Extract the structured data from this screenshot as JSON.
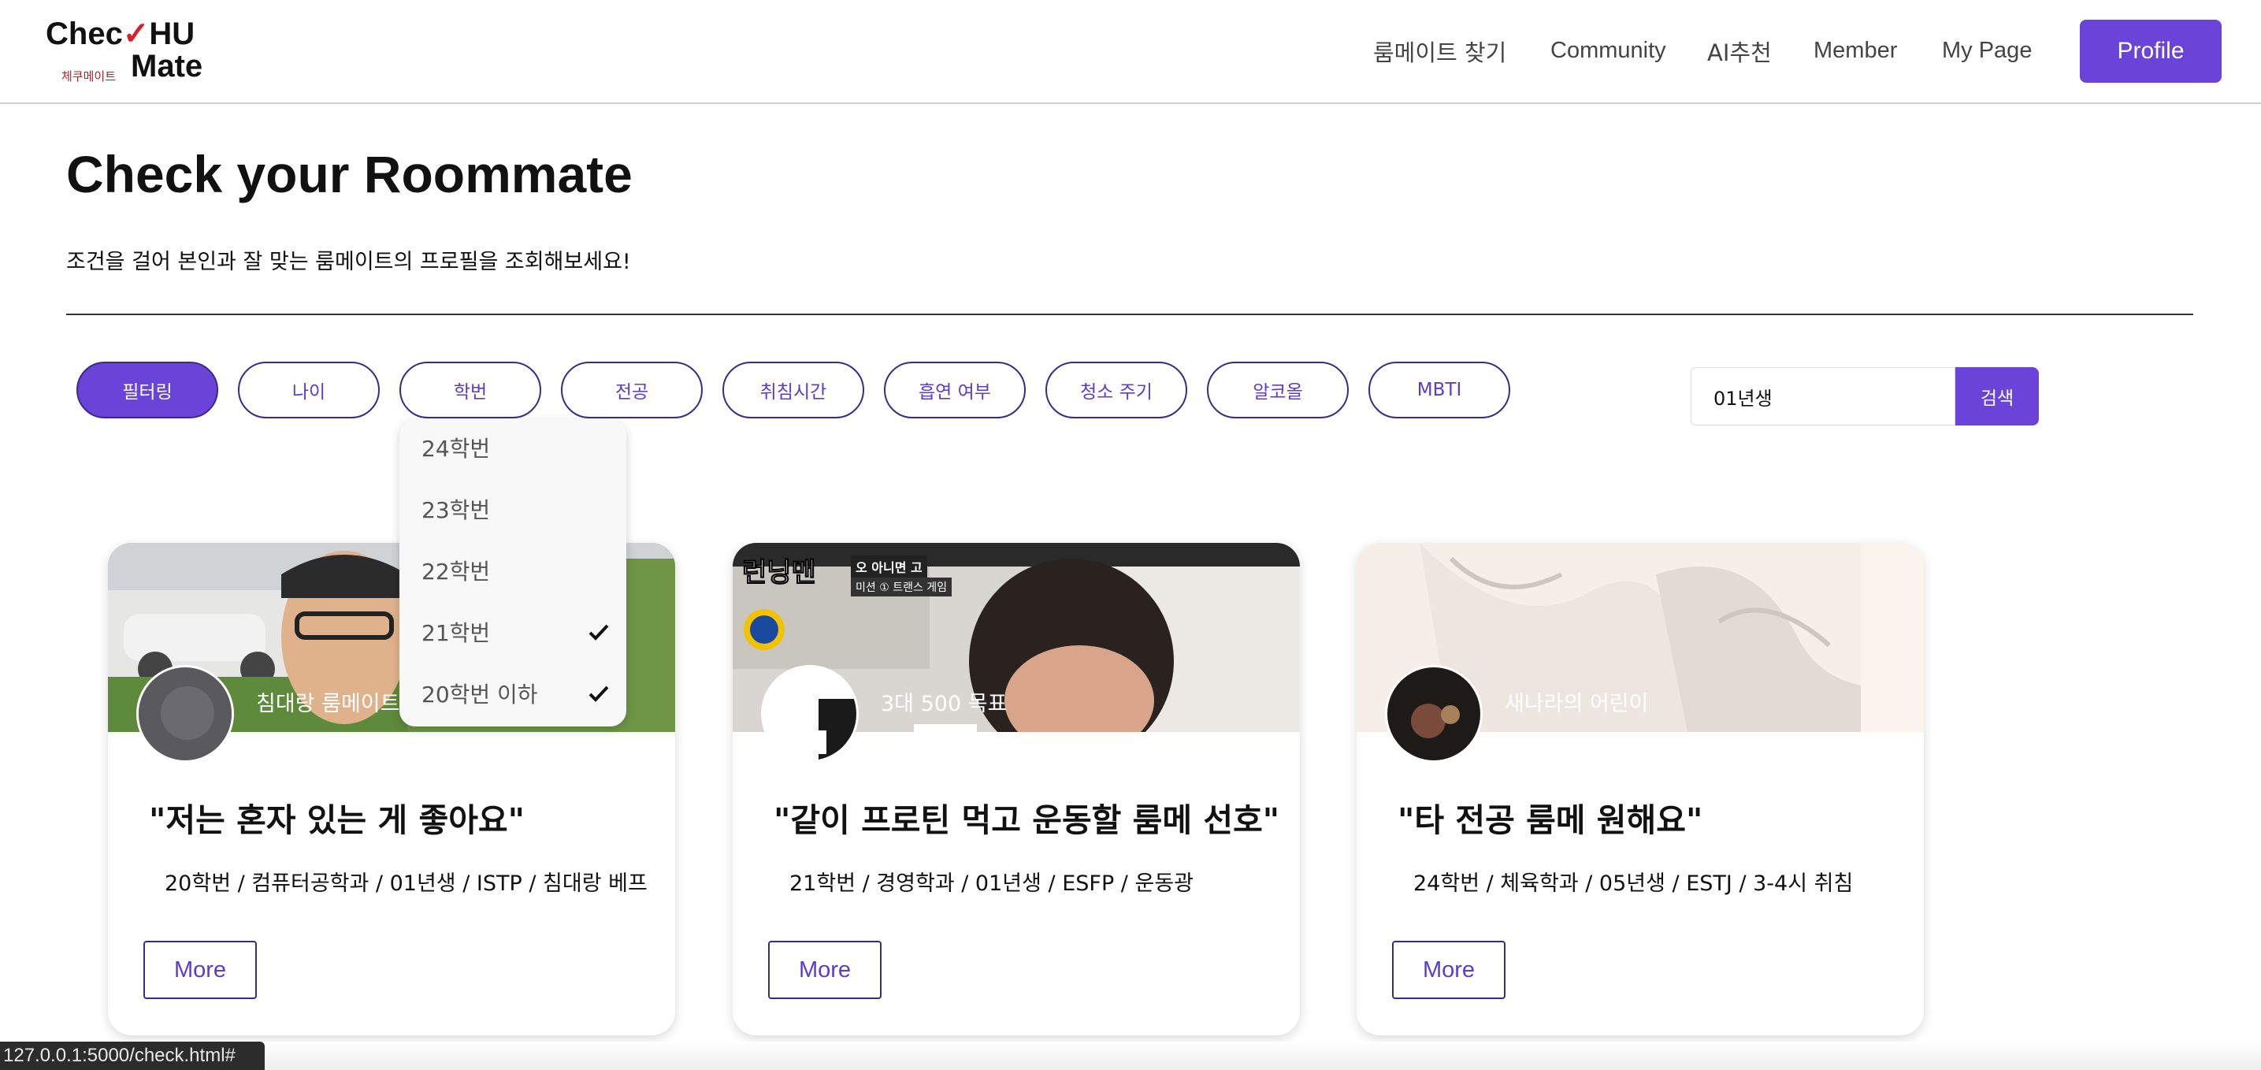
{
  "header": {
    "logo": {
      "line1": "Chec",
      "check": "✓",
      "line1_tail": "HU",
      "line2": "Mate",
      "sub": "체쿠메이트"
    },
    "nav": {
      "find_roommate": "룸메이트 찾기",
      "community": "Community",
      "ai_recommend": "AI추천",
      "member": "Member",
      "my_page": "My Page"
    },
    "profile_button": "Profile"
  },
  "page": {
    "title": "Check your Roommate",
    "description": "조건을 걸어 본인과 잘 맞는 룸메이트의 프로필을 조회해보세요!"
  },
  "filters": {
    "chips": [
      "필터링",
      "나이",
      "학번",
      "전공",
      "취침시간",
      "흡연 여부",
      "청소 주기",
      "알코올",
      "MBTI"
    ],
    "active_chip": "필터링",
    "search_value": "01년생",
    "search_button": "검색"
  },
  "dropdown": {
    "items": [
      {
        "label": "24학번",
        "checked": false
      },
      {
        "label": "23학번",
        "checked": false
      },
      {
        "label": "22학번",
        "checked": false
      },
      {
        "label": "21학번",
        "checked": true
      },
      {
        "label": "20학번 이하",
        "checked": true
      }
    ]
  },
  "cards": [
    {
      "nickname": "침대랑 룸메이트",
      "quote": "\"저는 혼자 있는 게 좋아요\"",
      "info": "20학번 / 컴퓨터공학과 / 01년생 / ISTP / 침대랑 베프",
      "more": "More"
    },
    {
      "nickname": "3대 500 목표",
      "quote": "\"같이 프로틴 먹고 운동할 룸메 선호\"",
      "info": "21학번 / 경영학과 / 01년생 / ESFP / 운동광",
      "more": "More",
      "image_caption_1": "런닝맨",
      "image_caption_2": "오 아니면 고",
      "image_caption_3": "미션 ① 트랜스 게임"
    },
    {
      "nickname": "새나라의 어린이",
      "quote": "\"타 전공 룸메 원해요\"",
      "info": "24학번 / 체육학과 / 05년생 / ESTJ / 3-4시 취침",
      "more": "More"
    }
  ],
  "status_bar": {
    "url": "127.0.0.1:5000/check.html#"
  },
  "colors": {
    "accent": "#6a44d8",
    "chip_border": "#3a2a8a",
    "logo_check": "#d6202a"
  },
  "icons": {
    "dropdown_check": "check-icon"
  }
}
